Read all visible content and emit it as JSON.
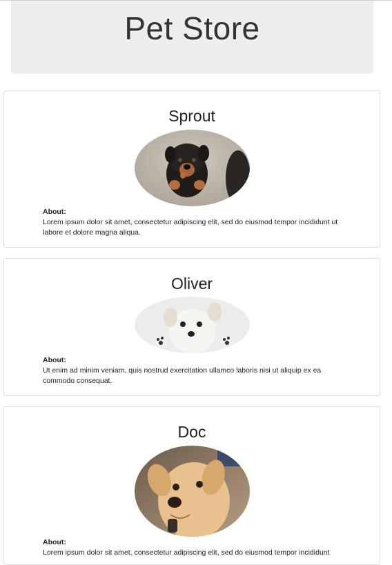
{
  "header": {
    "title": "Pet Store"
  },
  "pets": [
    {
      "name": "Sprout",
      "about_label": "About:",
      "about_text": "Lorem ipsum dolor sit amet, consectetur adipiscing elit, sed do eiusmod tempor incididunt ut labore et dolore magna aliqua.",
      "photo_icon": "rottweiler-puppy-photo"
    },
    {
      "name": "Oliver",
      "about_label": "About:",
      "about_text": "Ut enim ad minim veniam, quis nostrud exercitation ullamco laboris nisi ut aliquip ex ea commodo consequat.",
      "photo_icon": "white-puppy-photo"
    },
    {
      "name": "Doc",
      "about_label": "About:",
      "about_text": "Lorem ipsum dolor sit amet, consectetur adipiscing elit, sed do eiusmod tempor incididunt",
      "photo_icon": "golden-puppy-photo"
    }
  ]
}
